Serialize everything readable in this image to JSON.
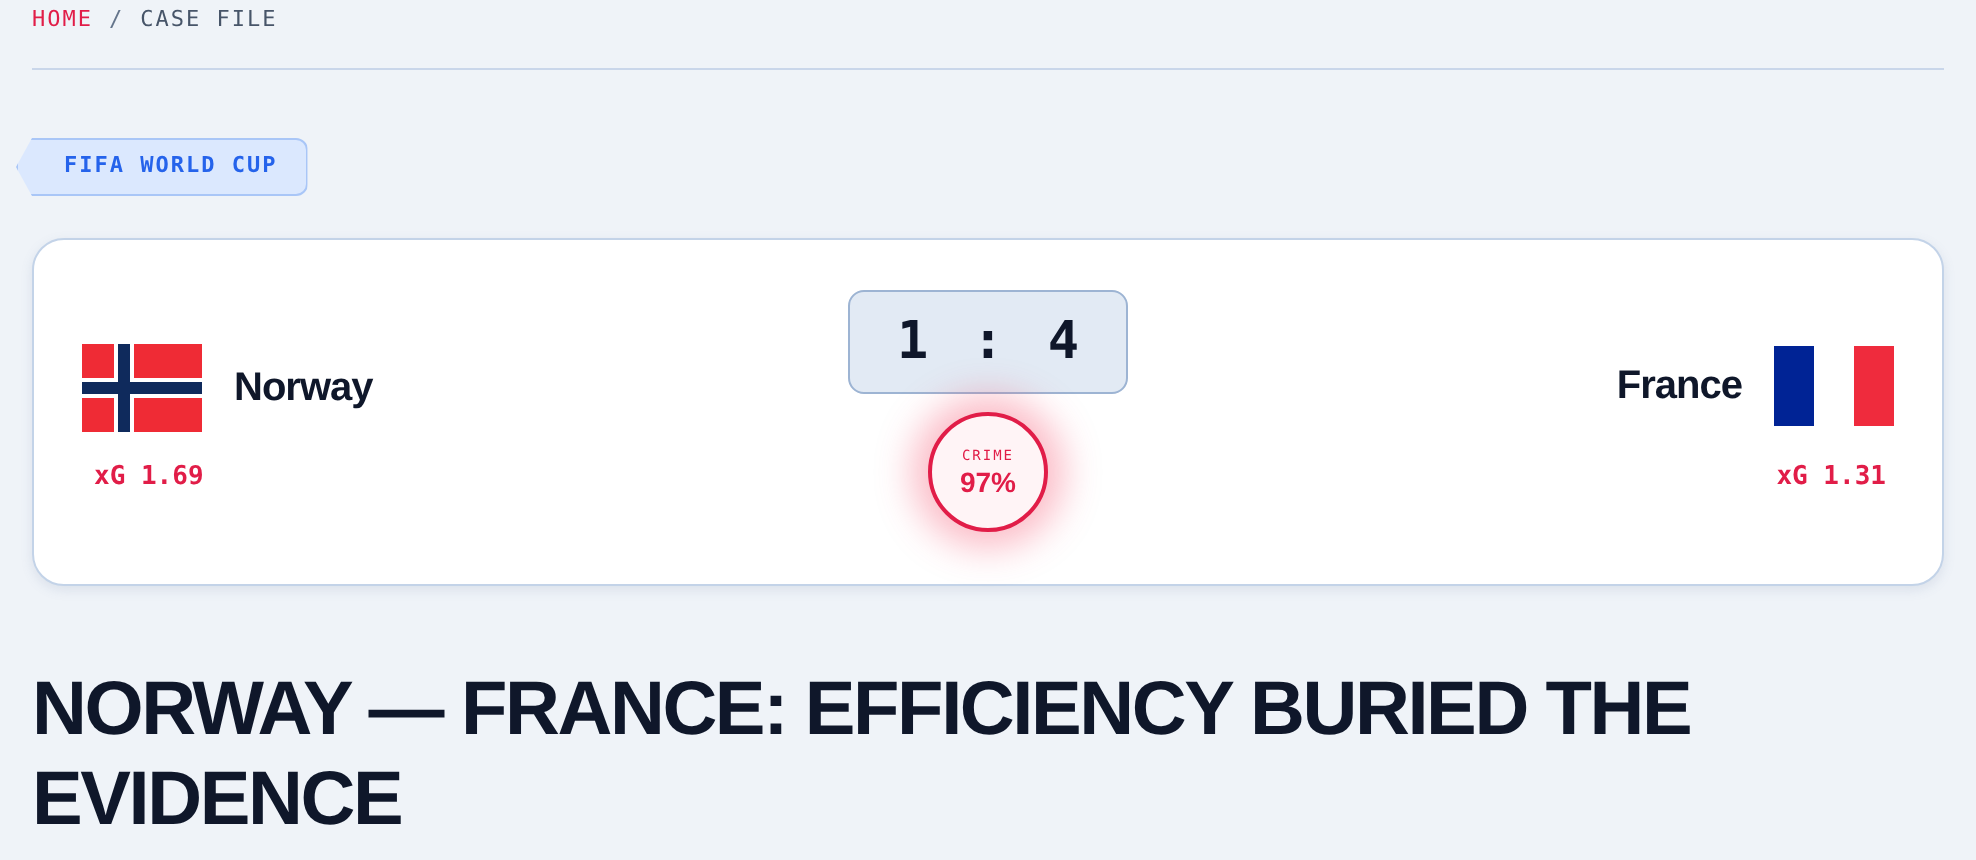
{
  "breadcrumb": {
    "home": "HOME",
    "separator": "/",
    "current": "CASE FILE"
  },
  "tag": "FIFA WORLD CUP",
  "match": {
    "home": {
      "name": "Norway",
      "xg": "xG 1.69"
    },
    "away": {
      "name": "France",
      "xg": "xG 1.31"
    },
    "score": {
      "home": "1",
      "separator": ":",
      "away": "4"
    },
    "crime": {
      "label": "CRIME",
      "value": "97%"
    }
  },
  "headline": "NORWAY — FRANCE: EFFICIENCY BURIED THE EVIDENCE"
}
